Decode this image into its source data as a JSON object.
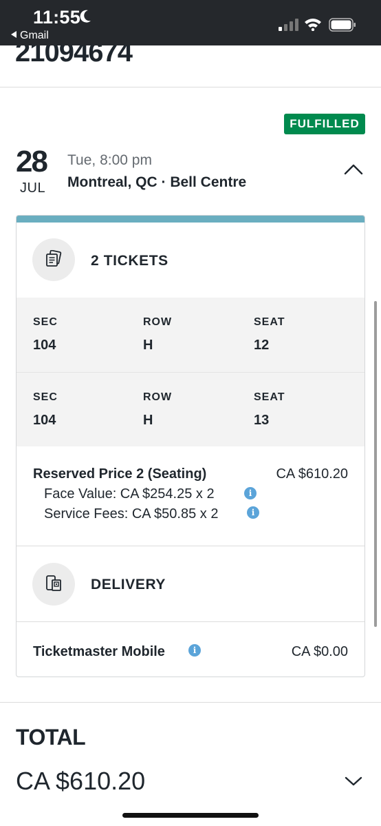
{
  "status_bar": {
    "time": "11:55",
    "back_app": "Gmail"
  },
  "order": {
    "number": "21094674"
  },
  "badge": {
    "label": "FULFILLED",
    "color": "#008a4e"
  },
  "event": {
    "day": "28",
    "month": "JUL",
    "time": "Tue, 8:00 pm",
    "venue": "Montreal, QC · Bell Centre"
  },
  "tickets": {
    "title": "2 TICKETS",
    "icon": "ticket-icon",
    "headers": {
      "sec": "SEC",
      "row": "ROW",
      "seat": "SEAT"
    },
    "rows": [
      {
        "sec": "104",
        "row": "H",
        "seat": "12"
      },
      {
        "sec": "104",
        "row": "H",
        "seat": "13"
      }
    ]
  },
  "price": {
    "title": "Reserved Price 2 (Seating)",
    "amount": "CA $610.20",
    "face_value": "Face Value: CA $254.25 x 2",
    "service_fees": "Service Fees: CA $50.85 x 2"
  },
  "delivery": {
    "title": "DELIVERY",
    "icon": "mobile-delivery-icon",
    "method": "Ticketmaster Mobile",
    "price": "CA $0.00"
  },
  "total": {
    "label": "TOTAL",
    "amount": "CA $610.20"
  },
  "colors": {
    "accent_bar": "#6aaec0",
    "info": "#5ba4d9",
    "status_bar": "#25282c"
  }
}
